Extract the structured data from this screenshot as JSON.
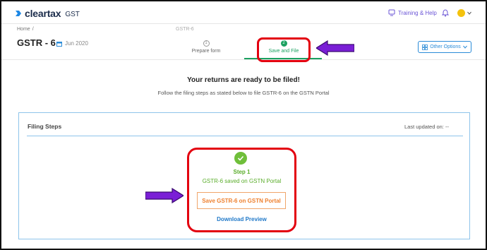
{
  "navbar": {
    "logo_text": "cleartax",
    "logo_sub": "GST",
    "help_label": "Training & Help",
    "brand_color": "#1a2b4a",
    "help_color": "#6b55d6"
  },
  "breadcrumb": {
    "home": "Home",
    "separator": "/",
    "current": "GSTR-6"
  },
  "page": {
    "title": "GSTR - 6",
    "period": "Jun 2020"
  },
  "steps": [
    {
      "number": "1",
      "label": "Prepare form",
      "state": "inactive"
    },
    {
      "number": "2",
      "label": "Save and File",
      "state": "active"
    }
  ],
  "other_options_label": "Other Options",
  "main": {
    "heading": "Your returns are ready to be filed!",
    "subheading": "Follow the filing steps as stated below to file GSTR-6 on the GSTN Portal"
  },
  "card": {
    "title": "Filing Steps",
    "last_updated": "Last updated on: --"
  },
  "filing_step": {
    "label": "Step 1",
    "status": "GSTR-6 saved on GSTN Portal",
    "action_label": "Save GSTR-6 on GSTN Portal",
    "preview_label": "Download Preview"
  },
  "colors": {
    "accent_green": "#1aa160",
    "step_green": "#5aad2a",
    "action_orange": "#ee7f2d",
    "link_blue": "#1f78c8",
    "annotation_red": "#e3000f",
    "annotation_arrow": "#7a1fd6"
  },
  "icons": {
    "logo": "cleartax-logo-icon",
    "help": "training-help-icon",
    "bell": "bell-icon",
    "calendar": "calendar-icon",
    "grid": "grid-icon",
    "check": "check-circle-icon"
  }
}
